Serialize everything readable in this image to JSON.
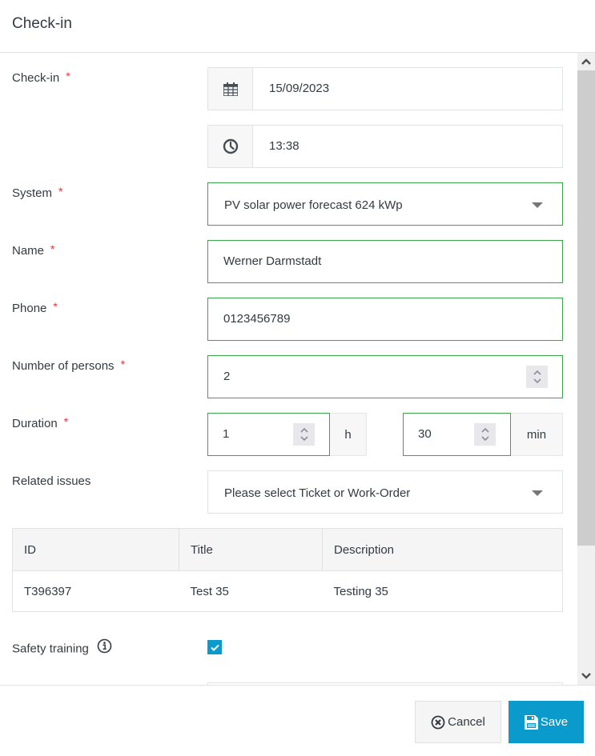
{
  "modal": {
    "title": "Check-in"
  },
  "form": {
    "checkin": {
      "label": "Check-in",
      "required_mark": "*",
      "date_icon": "calendar-icon",
      "date_value": "15/09/2023",
      "time_icon": "clock-icon",
      "time_value": "13:38"
    },
    "system": {
      "label": "System",
      "required_mark": "*",
      "selected": "PV solar power forecast 624 kWp"
    },
    "name": {
      "label": "Name",
      "required_mark": "*",
      "value": "Werner Darmstadt"
    },
    "phone": {
      "label": "Phone",
      "required_mark": "*",
      "value": "0123456789"
    },
    "persons": {
      "label": "Number of persons",
      "required_mark": "*",
      "value": "2"
    },
    "duration": {
      "label": "Duration",
      "required_mark": "*",
      "hours_value": "1",
      "hours_unit": "h",
      "minutes_value": "30",
      "minutes_unit": "min"
    },
    "related_issues": {
      "label": "Related issues",
      "placeholder": "Please select Ticket or Work-Order",
      "table": {
        "headers": [
          "ID",
          "Title",
          "Description"
        ],
        "rows": [
          [
            "T396397",
            "Test 35",
            "Testing 35"
          ]
        ]
      }
    },
    "safety_training": {
      "label": "Safety training",
      "info_icon": "info-icon",
      "checked": true
    }
  },
  "footer": {
    "cancel_label": "Cancel",
    "cancel_icon": "close-circle-icon",
    "save_label": "Save",
    "save_icon": "floppy-disk-icon"
  },
  "colors": {
    "valid_border": "#3aa547",
    "required": "#e8333c",
    "primary": "#0a9acc"
  }
}
